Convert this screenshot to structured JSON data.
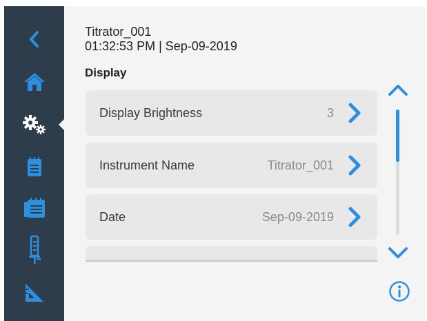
{
  "header": {
    "instrument": "Titrator_001",
    "datetime": "01:32:53 PM | Sep-09-2019"
  },
  "section_title": "Display",
  "rows": [
    {
      "label": "Display Brightness",
      "value": "3"
    },
    {
      "label": "Instrument Name",
      "value": "Titrator_001"
    },
    {
      "label": "Date",
      "value": "Sep-09-2019"
    }
  ],
  "sidebar": {
    "items": [
      {
        "icon": "back-chevron-icon"
      },
      {
        "icon": "home-icon"
      },
      {
        "icon": "settings-gears-icon",
        "active": true
      },
      {
        "icon": "notepad-icon"
      },
      {
        "icon": "reports-calendar-icon"
      },
      {
        "icon": "burette-icon"
      },
      {
        "icon": "ruler-triangle-icon"
      }
    ]
  },
  "scrollbar": {
    "position": 0.0,
    "visible_fraction": 0.42
  },
  "colors": {
    "sidebar": "#2d3d4b",
    "accent": "#2c8fe0",
    "background": "#f4f4f4",
    "row_background": "#e8e8e8"
  }
}
